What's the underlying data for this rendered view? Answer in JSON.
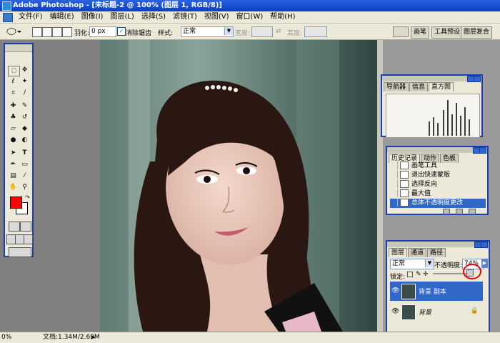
{
  "window": {
    "title": "Adobe Photoshop - [未标题-2 @ 100% (图层 1, RGB/8)]"
  },
  "menu": [
    "文件(F)",
    "编辑(E)",
    "图像(I)",
    "图层(L)",
    "选择(S)",
    "滤镜(T)",
    "视图(V)",
    "窗口(W)",
    "帮助(H)"
  ],
  "options": {
    "feather_label": "羽化:",
    "feather_value": "0 px",
    "antialias_label": "消除锯齿",
    "style_label": "样式:",
    "style_value": "正常",
    "width_label": "宽度:",
    "height_label": "高度:"
  },
  "palette_well": [
    "画笔",
    "工具预设",
    "图层复合"
  ],
  "navigator_panel": {
    "tabs": [
      "导航器",
      "信息",
      "直方图"
    ],
    "active_tab": "直方图"
  },
  "history_panel": {
    "tabs": [
      "历史记录",
      "动作",
      "色板"
    ],
    "items": [
      "画笔工具",
      "退出快速蒙版",
      "选择反向",
      "最大值",
      "总体不透明度更改"
    ],
    "selected_index": 4
  },
  "layers_panel": {
    "tabs": [
      "图层",
      "通道",
      "路径"
    ],
    "blend_mode": "正常",
    "opacity_label": "不透明度:",
    "opacity_value": "74%",
    "lock_label": "锁定:",
    "layers": [
      {
        "name": "背景 副本",
        "selected": true
      },
      {
        "name": "背景",
        "selected": false
      }
    ]
  },
  "status": {
    "zoom": "0%",
    "doc_size": "文档:1.34M/2.69M"
  },
  "colors": {
    "foreground": "#ff0000",
    "background": "#ffffff",
    "panel_border": "#1b3fae",
    "selection": "#3168c8"
  }
}
